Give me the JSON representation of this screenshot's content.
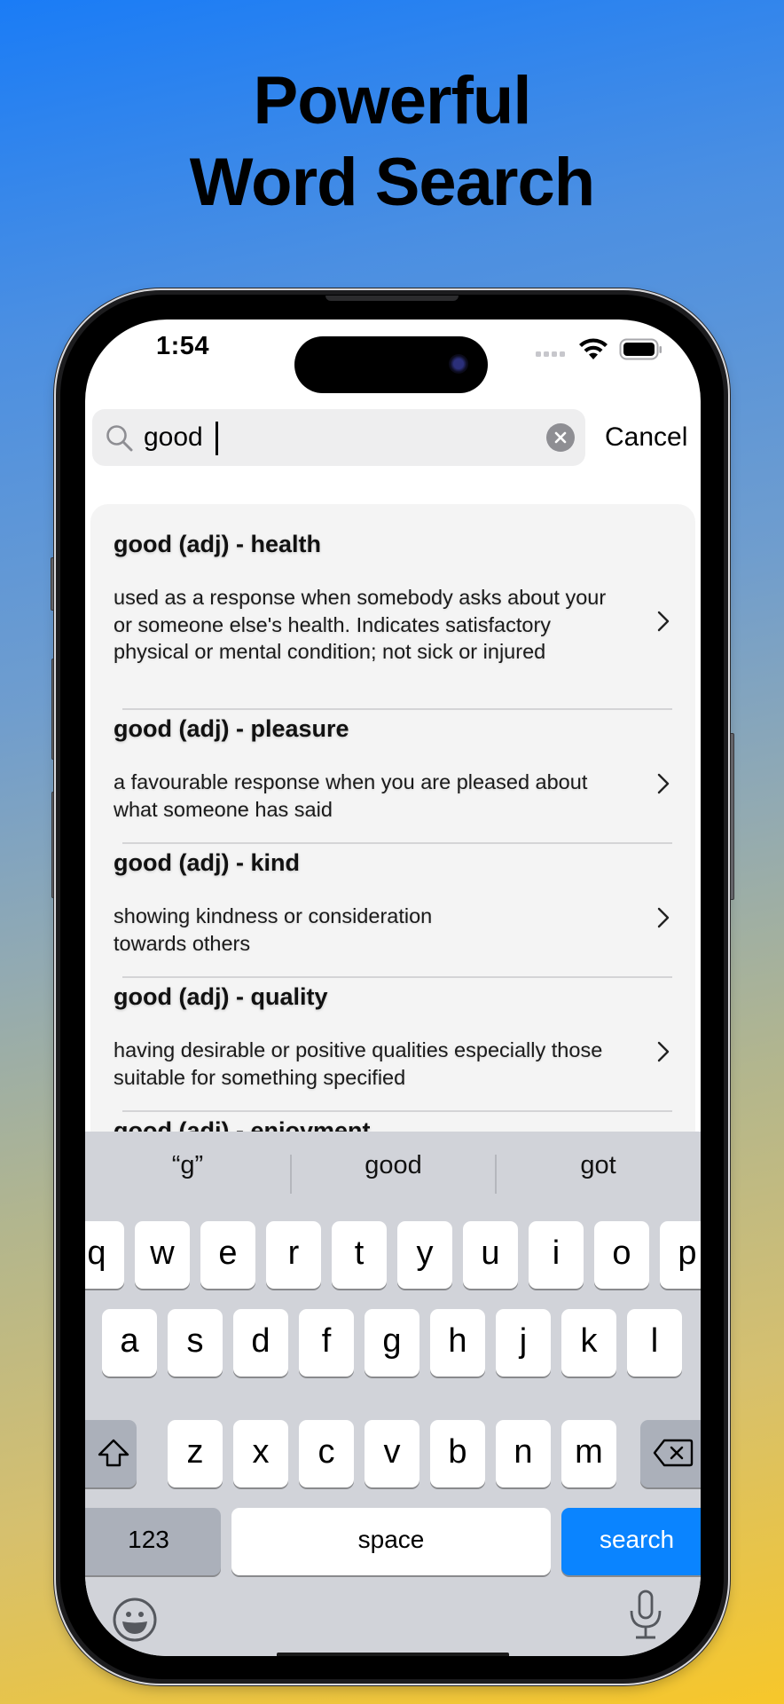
{
  "headline": {
    "line1": "Powerful",
    "line2": "Word Search"
  },
  "status_bar": {
    "time": "1:54",
    "icons": [
      "cellular-dots-icon",
      "wifi-icon",
      "battery-icon"
    ]
  },
  "search": {
    "value": "good",
    "placeholder": "",
    "cancel_label": "Cancel",
    "clear_icon": "clear-circle-icon",
    "search_icon": "magnifier-icon"
  },
  "results": [
    {
      "title": "good (adj) - health",
      "description": "used as a response when somebody asks about your or someone else's health. Indicates satisfactory physical or mental condition; not sick or injured"
    },
    {
      "title": "good (adj) - pleasure",
      "description": "a favourable response when you are pleased about what someone has said"
    },
    {
      "title": "good (adj) - kind",
      "description": "showing kindness or consideration towards others"
    },
    {
      "title": "good (adj) - quality",
      "description": "having desirable or positive qualities especially those suitable for something specified"
    },
    {
      "title": "good (adj) - enjoyment",
      "description": ""
    }
  ],
  "keyboard": {
    "predictions": [
      "“g”",
      "good",
      "got"
    ],
    "row1": [
      "q",
      "w",
      "e",
      "r",
      "t",
      "y",
      "u",
      "i",
      "o",
      "p"
    ],
    "row2": [
      "a",
      "s",
      "d",
      "f",
      "g",
      "h",
      "j",
      "k",
      "l"
    ],
    "row3": [
      "z",
      "x",
      "c",
      "v",
      "b",
      "n",
      "m"
    ],
    "shift_icon": "shift-arrow-icon",
    "delete_icon": "backspace-icon",
    "numbers_label": "123",
    "space_label": "space",
    "return_label": "search",
    "emoji_icon": "emoji-smile-icon",
    "mic_icon": "microphone-icon",
    "accent_color": "#0a84ff"
  }
}
